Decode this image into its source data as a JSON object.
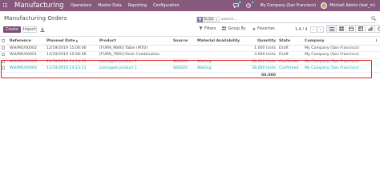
{
  "topbar": {
    "app_name": "Manufacturing",
    "menu": [
      "Operations",
      "Master Data",
      "Reporting",
      "Configuration"
    ],
    "messages_count": "6",
    "activities_count": "5",
    "company": "My Company (San Francisco)",
    "user": "Mitchell Admin (test_m)"
  },
  "control": {
    "breadcrumb": "Manufacturing Orders",
    "create_label": "Create",
    "import_label": "Import",
    "search": {
      "facet_label": "To Do",
      "placeholder": "Search..."
    },
    "filters_label": "Filters",
    "group_by_label": "Group By",
    "favorites_label": "Favorites",
    "pager": "1-4 / 4"
  },
  "table": {
    "headers": [
      "Reference",
      "Planned Date",
      "Product",
      "Source",
      "Material Availability",
      "Quantity",
      "State",
      "Company"
    ],
    "rows": [
      {
        "reference": "WH/MO/00002",
        "date": "12/19/2019 15:06:06",
        "product": "[FURN_9666] Table (MTO)",
        "source": "",
        "availability": "",
        "quantity": "1.000",
        "unit": "Units",
        "state": "Draft",
        "company": "My Company (San Francisco)"
      },
      {
        "reference": "WH/MO/00001",
        "date": "12/19/2019 15:06:06",
        "product": "[FURN_7800] Desk Combination",
        "source": "",
        "availability": "",
        "quantity": "3.000",
        "unit": "Units",
        "state": "Draft",
        "company": "My Company (San Francisco)"
      },
      {
        "reference": "WH/MO/00005",
        "date": "12/19/2019 14:13:11",
        "product": "packaged product 2",
        "source": "S00020",
        "availability": "Waiting",
        "quantity": "38.000",
        "unit": "Units",
        "state": "Confirmed",
        "company": "My Company (San Francisco)"
      },
      {
        "reference": "WH/MO/00004",
        "date": "12/19/2019 14:13:11",
        "product": "packaged product 1",
        "source": "S00020",
        "availability": "Waiting",
        "quantity": "38.000",
        "unit": "Units",
        "state": "Confirmed",
        "company": "My Company (San Francisco)"
      }
    ],
    "total_quantity": "80.000"
  }
}
